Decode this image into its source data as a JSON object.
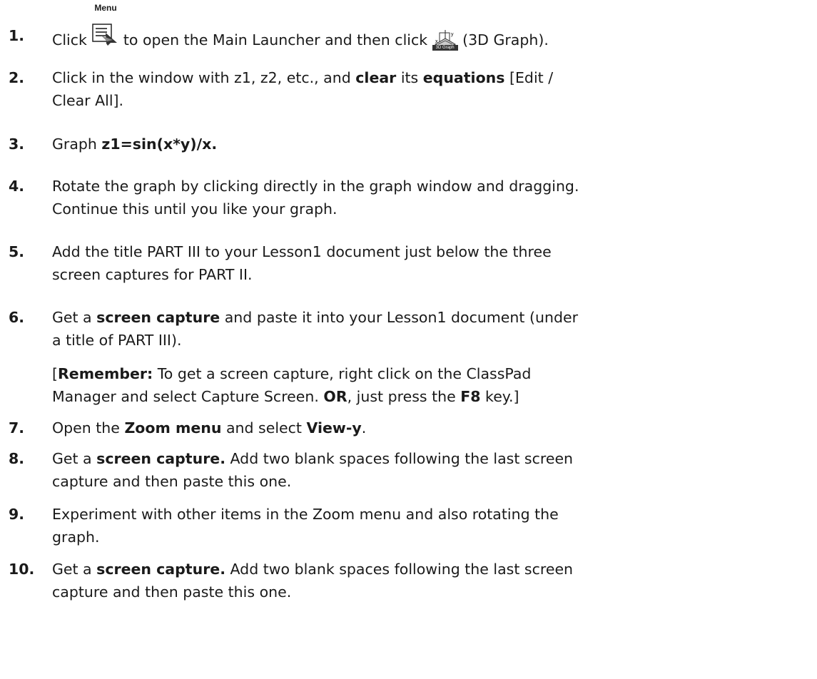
{
  "steps": [
    {
      "num": "1.",
      "t1": "Click ",
      "menu_label": "Menu",
      "t2": " to open the Main Launcher and then click ",
      "graph3d_label": "3D Graph",
      "t3": " (3D Graph)."
    },
    {
      "num": "2.",
      "t1": "Click in the window with z1, z2, etc., and ",
      "b1": "clear",
      "t2": " its ",
      "b2": "equations",
      "t3": " [Edit /",
      "line2": "Clear All]."
    },
    {
      "num": "3.",
      "t1": "Graph ",
      "b1": "z1=sin(x*y)/x."
    },
    {
      "num": "4.",
      "line1": "Rotate the graph by clicking directly in the graph window and dragging.",
      "line2": "Continue this until you like your graph."
    },
    {
      "num": "5.",
      "line1": "Add the title PART III to your Lesson1 document just below the three",
      "line2": "screen captures for PART II."
    },
    {
      "num": "6.",
      "t1": "Get a ",
      "b1": "screen capture",
      "t2": " and paste it into your Lesson1 document (under",
      "line2": "a title of PART III)."
    },
    {
      "num": "7.",
      "t1": "Open the ",
      "b1": "Zoom menu",
      "t2": " and select ",
      "b2": "View-y",
      "t3": "."
    },
    {
      "num": "8.",
      "t1": "Get a ",
      "b1": "screen capture.",
      "t2": " Add two blank spaces following the last screen",
      "line2": "capture and then paste this one."
    },
    {
      "num": "9.",
      "line1": "Experiment with other items in the Zoom menu and also rotating the",
      "line2": "graph."
    },
    {
      "num": "10.",
      "t1": "Get a ",
      "b1": "screen capture.",
      "t2": " Add two blank spaces following the last screen",
      "line2": "capture and then paste this one."
    }
  ],
  "note": {
    "t1": "[",
    "b1": "Remember:",
    "t2": " To get a screen capture, right click on the ClassPad",
    "line2a": "Manager and select Capture Screen. ",
    "b2": "OR",
    "t3": ", just press the ",
    "b3": "F8",
    "t4": " key.]"
  },
  "icons": {
    "menu": "menu-launcher-icon",
    "graph3d": "3d-graph-icon"
  }
}
